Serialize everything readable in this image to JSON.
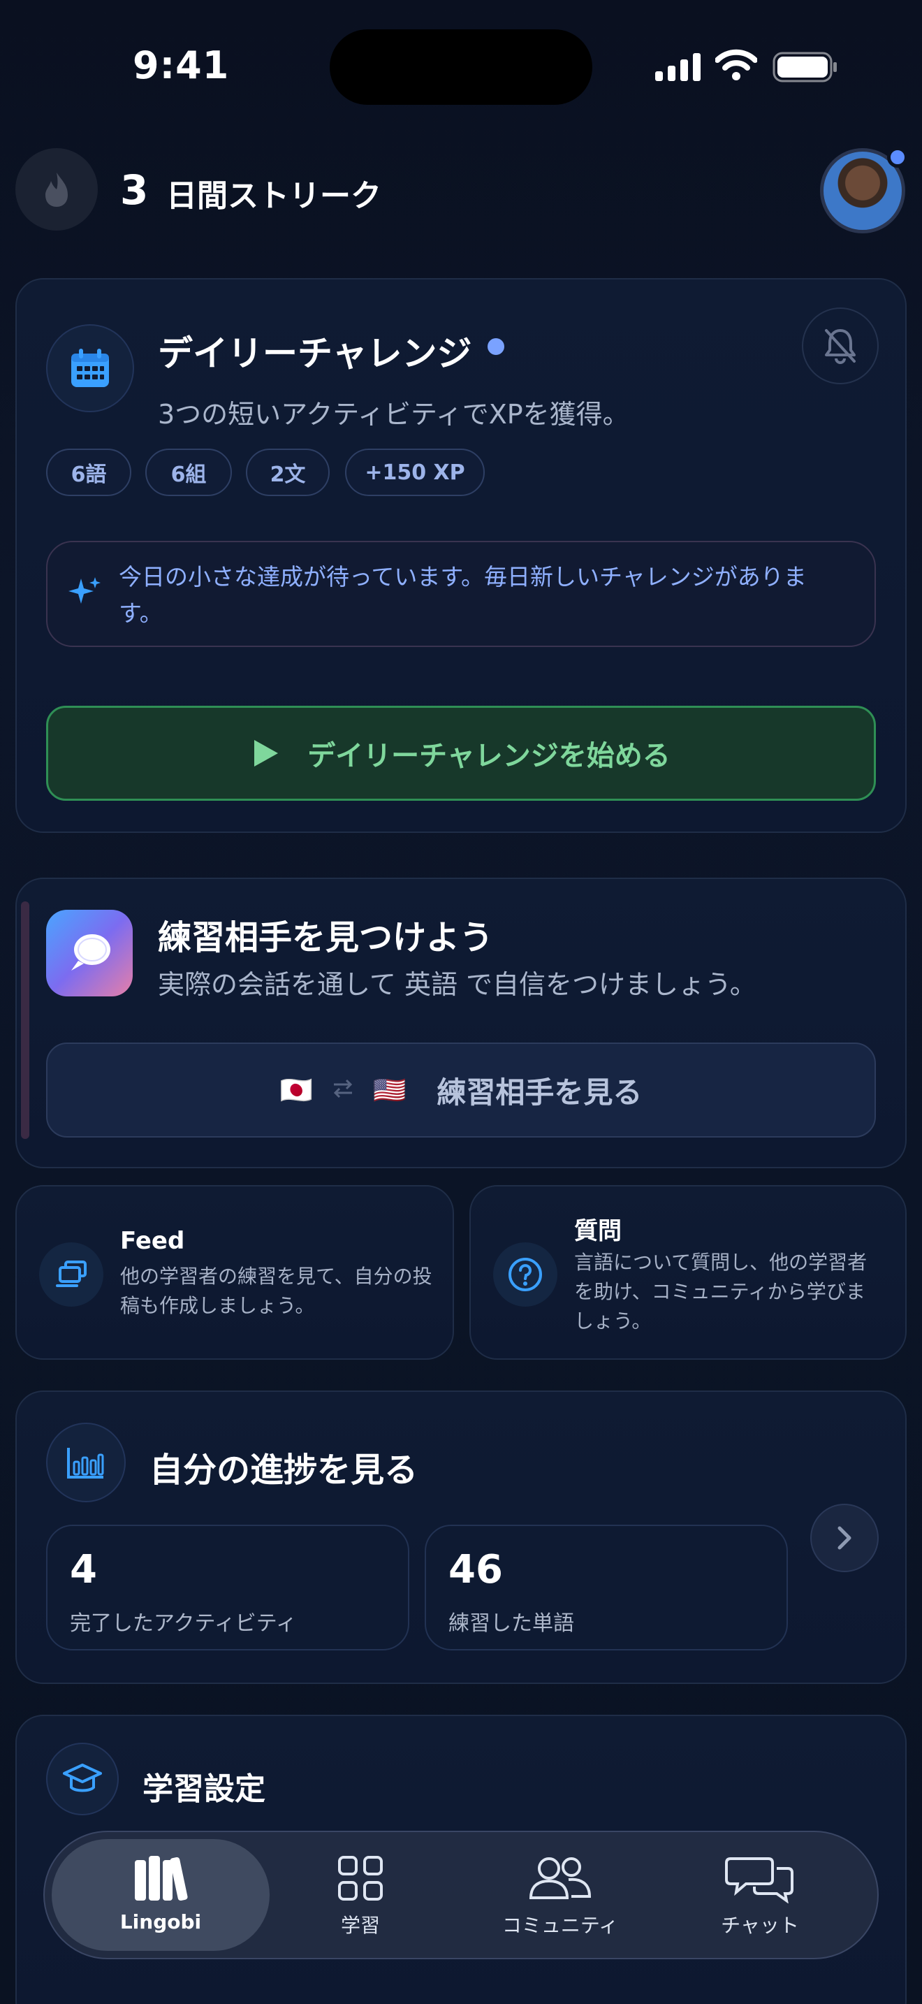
{
  "status_bar": {
    "time": "9:41"
  },
  "header": {
    "streak_count": "3",
    "streak_label": "日間ストリーク"
  },
  "daily_challenge": {
    "title": "デイリーチャレンジ",
    "subtitle": "3つの短いアクティビティでXPを獲得。",
    "chips": [
      "6語",
      "6組",
      "2文",
      "+150 XP"
    ],
    "note": "今日の小さな達成が待っています。毎日新しいチャレンジがあります。",
    "start_label": "デイリーチャレンジを始める"
  },
  "partner": {
    "title": "練習相手を見つけよう",
    "subtitle": "実際の会話を通して 英語 で自信をつけましょう。",
    "button_label": "練習相手を見る",
    "from_flag": "🇯🇵",
    "to_flag": "🇺🇸"
  },
  "feed": {
    "title": "Feed",
    "subtitle": "他の学習者の練習を見て、自分の投稿も作成しましょう。"
  },
  "questions": {
    "title": "質問",
    "subtitle": "言語について質問し、他の学習者を助け、コミュニティから学びましょう。"
  },
  "progress": {
    "title": "自分の進捗を見る",
    "stats": [
      {
        "value": "4",
        "label": "完了したアクティビティ"
      },
      {
        "value": "46",
        "label": "練習した単語"
      }
    ]
  },
  "learning_settings": {
    "title": "学習設定"
  },
  "tabbar": {
    "tabs": [
      {
        "label": "Lingobi",
        "icon": "library-icon",
        "active": true
      },
      {
        "label": "学習",
        "icon": "grid-icon",
        "active": false
      },
      {
        "label": "コミュニティ",
        "icon": "people-icon",
        "active": false
      },
      {
        "label": "チャット",
        "icon": "chat-bubbles-icon",
        "active": false
      }
    ]
  },
  "colors": {
    "accent_blue": "#5b8cff",
    "start_green": "#7fd79c",
    "background": "#0b1426"
  }
}
